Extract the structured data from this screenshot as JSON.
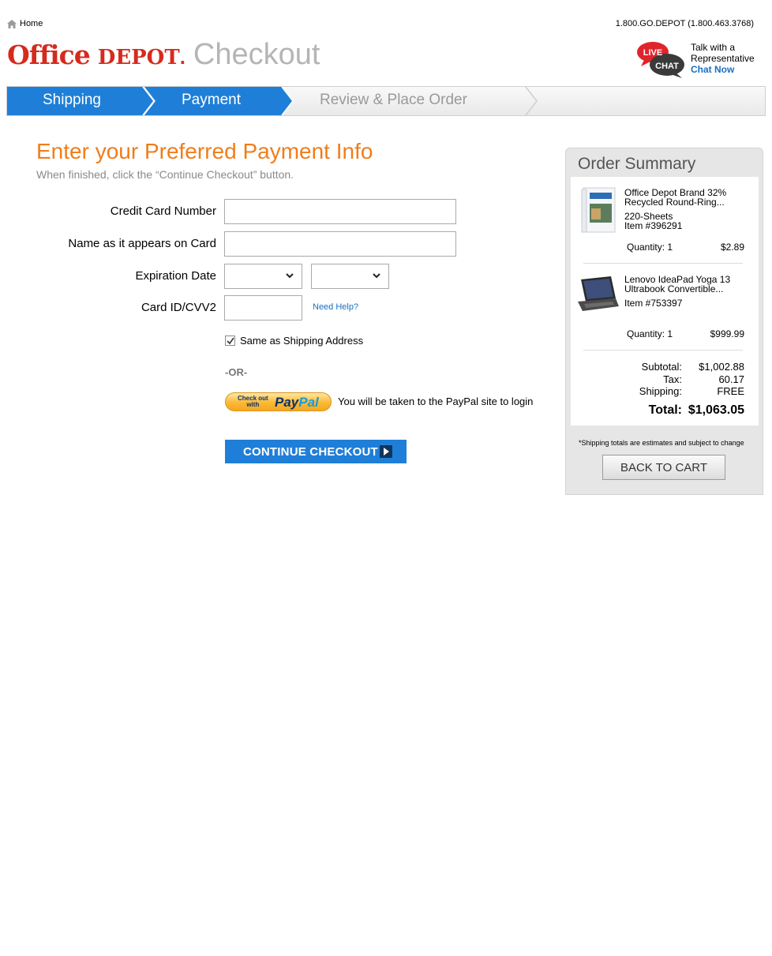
{
  "header": {
    "home_label": "Home",
    "phone": "1.800.GO.DEPOT (1.800.463.3768)",
    "logo_office": "Office",
    "logo_depot": "DEPOT",
    "logo_dot": ".",
    "checkout_title": "Checkout",
    "brand_color": "#d52b1e",
    "chat": {
      "badge_live": "LIVE",
      "badge_chat": "CHAT",
      "line1": "Talk with a",
      "line2": "Representative",
      "link": "Chat Now"
    }
  },
  "steps": [
    {
      "label": "Shipping",
      "state": "complete"
    },
    {
      "label": "Payment",
      "state": "current"
    },
    {
      "label": "Review & Place Order",
      "state": "upcoming"
    }
  ],
  "main": {
    "heading": "Enter your Preferred Payment Info",
    "subheading": "When finished, click the “Continue Checkout” button.",
    "accent_color": "#f07d1a"
  },
  "form": {
    "card_number": {
      "label": "Credit Card Number",
      "value": ""
    },
    "name_on_card": {
      "label": "Name as it appears on Card",
      "value": ""
    },
    "expiration": {
      "label": "Expiration Date",
      "month": "",
      "year": ""
    },
    "cvv": {
      "label": "Card ID/CVV2",
      "value": "",
      "help": "Need Help?"
    },
    "same_as_shipping": {
      "label": "Same as Shipping Address",
      "checked": true
    },
    "or_text": "-OR-",
    "paypal": {
      "small_top": "Check out",
      "small_bottom": "with",
      "brand_a": "Pay",
      "brand_b": "Pal",
      "note": "You will be taken to the PayPal site to login"
    },
    "continue_label": "CONTINUE CHECKOUT"
  },
  "summary": {
    "title": "Order Summary",
    "items": [
      {
        "name_line1": "Office Depot Brand 32%",
        "name_line2": "Recycled Round-Ring...",
        "detail": "220-Sheets",
        "item_no": "Item #396291",
        "quantity": "Quantity: 1",
        "price": "$2.89",
        "thumb_icon": "binder-icon"
      },
      {
        "name_line1": "Lenovo IdeaPad Yoga 13",
        "name_line2": "Ultrabook Convertible...",
        "detail": "",
        "item_no": "Item #753397",
        "quantity": "Quantity: 1",
        "price": "$999.99",
        "thumb_icon": "laptop-icon"
      }
    ],
    "subtotal_label": "Subtotal:",
    "subtotal": "$1,002.88",
    "tax_label": "Tax:",
    "tax": "60.17",
    "shipping_label": "Shipping:",
    "shipping": "FREE",
    "total_label": "Total:",
    "total": "$1,063.05",
    "note": "*Shipping totals are estimates and subject to change",
    "back_label": "BACK TO CART"
  }
}
